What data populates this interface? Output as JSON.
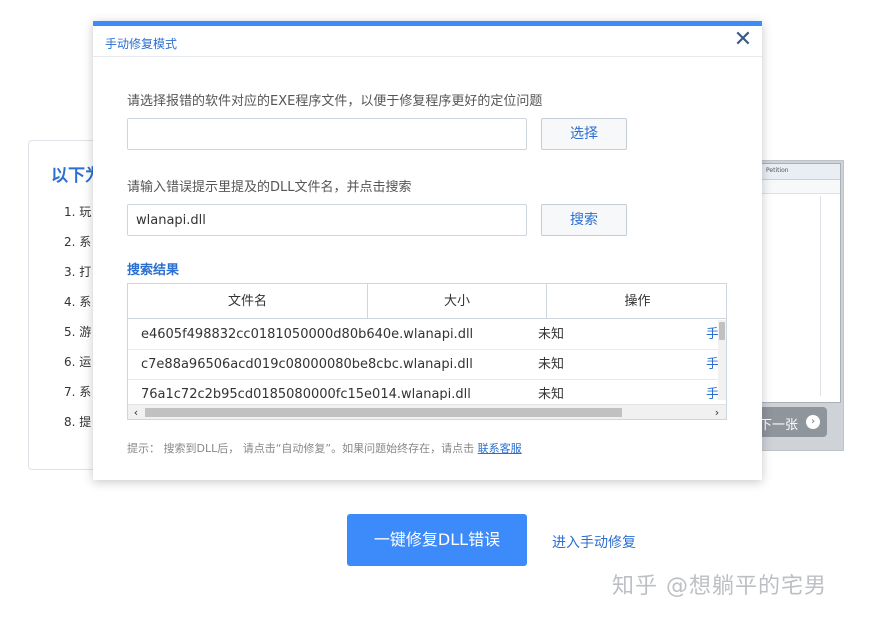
{
  "background": {
    "heading": "以下为",
    "list": [
      "1. 玩",
      "2. 系",
      "3. 打",
      "4. 系",
      "5. 游",
      "6. 运",
      "7. 系",
      "8. 提"
    ],
    "preview_title": "Petition",
    "next_label": "下一张",
    "fix_button": "一键修复DLL错误",
    "manual_link": "进入手动修复",
    "watermark": "知乎 @想躺平的宅男"
  },
  "dialog": {
    "title": "手动修复模式",
    "close_symbol": "✕",
    "exe_label": "请选择报错的软件对应的EXE程序文件，以便于修复程序更好的定位问题",
    "exe_value": "",
    "select_button": "选择",
    "dll_label": "请输入错误提示里提及的DLL文件名，并点击搜索",
    "dll_value": "wlanapi.dll",
    "search_button": "搜索",
    "results_title": "搜索结果",
    "columns": [
      "文件名",
      "大小",
      "操作"
    ],
    "rows": [
      {
        "name": "e4605f498832cc0181050000d80b640e.wlanapi.dll",
        "size": "未知",
        "op": "手动"
      },
      {
        "name": "c7e88a96506acd019c08000080be8cbc.wlanapi.dll",
        "size": "未知",
        "op": "手动"
      },
      {
        "name": "76a1c72c2b95cd0185080000fc15e014.wlanapi.dll",
        "size": "未知",
        "op": "手动"
      }
    ],
    "tip_text": "提示： 搜索到DLL后， 请点击“自动修复”。如果问题始终存在，请点击",
    "tip_link": "联系客服"
  }
}
